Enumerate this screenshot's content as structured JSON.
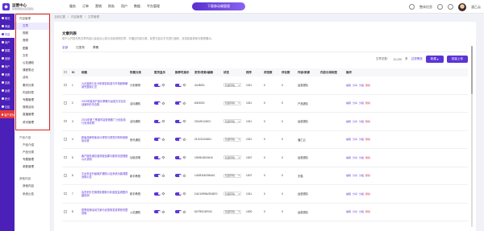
{
  "logo": {
    "title": "运营中心",
    "subtitle": "铁收钢组合运营团队"
  },
  "nav": [
    "服务",
    "订单",
    "营销",
    "财务",
    "用户",
    "数据",
    "平台管理"
  ],
  "promo_label": "下载移动端管理",
  "top_right": {
    "org": "整体信息",
    "user": "潘乙云"
  },
  "sidebar": [
    {
      "label": "概况",
      "name": "sidebar-item-overview"
    },
    {
      "label": "商品",
      "name": "sidebar-item-goods"
    },
    {
      "label": "内容",
      "name": "sidebar-item-content",
      "active": true
    },
    {
      "label": "用户",
      "name": "sidebar-item-users"
    },
    {
      "label": "数据",
      "name": "sidebar-item-data"
    },
    {
      "label": "营销",
      "name": "sidebar-item-marketing"
    },
    {
      "label": "商户",
      "name": "sidebar-item-merchants"
    },
    {
      "label": "设置",
      "name": "sidebar-item-settings"
    },
    {
      "label": "应用",
      "name": "sidebar-item-apps"
    },
    {
      "label": "运营",
      "name": "sidebar-item-ops"
    },
    {
      "label": "积分",
      "name": "sidebar-item-points"
    },
    {
      "label": "社区",
      "name": "sidebar-item-community"
    },
    {
      "label": "客户成功",
      "name": "sidebar-item-success",
      "red": true
    }
  ],
  "subnav": {
    "group1": "内容管理",
    "items": [
      "文章",
      "视频",
      "音频",
      "图集",
      "文件",
      "公告通知",
      "课程笔记",
      "活动",
      "素材分类",
      "内容标签",
      "专题管理",
      "音频活动",
      "直播管理",
      "资讯管理"
    ],
    "group2": "产品介绍",
    "items2": [
      "产品介绍",
      "产品分类",
      "专题管理",
      "参数管理"
    ],
    "group3": "其他内容",
    "items3": [
      "其他内容",
      "系统公告"
    ]
  },
  "breadcrumb": [
    "当前位置",
    "内容管理",
    "文章管理"
  ],
  "page": {
    "title": "文章列表",
    "desc1": "用于公开发布的文章内容以及站点公告与活动说明文章，可通过内容分类、标签与显示方式进行组织，支持批量排序与推荐展示。",
    "tabs": [
      "全部",
      "已发布",
      "草稿"
    ]
  },
  "toolbar": {
    "count_label": "文章总数：",
    "count": "10,230",
    "unit": "条",
    "filter": "过滤筛选",
    "new_btn": "新建",
    "batch_btn": "批量上传"
  },
  "table": {
    "headers": [
      "",
      "ID",
      "标题",
      "所属分类",
      "首页显示",
      "推荐可展示",
      "发布/更新/编辑",
      "状态",
      "排序",
      "浏览数",
      "评论数",
      "作者/来源",
      "内容分类标签",
      "操作"
    ],
    "rows": [
      {
        "id": "1",
        "title": "九月最新行业分析报告精选与市场趋势解读完整版汇总",
        "cat": "计划案例",
        "date": "4/1/8001",
        "status": "隐藏草稿",
        "sort": "1011",
        "hits": "0",
        "cmt": "0",
        "src": "运营团队"
      },
      {
        "id": "2",
        "title": "2023年度用户增长策略与运营方法论实战案例分享合集",
        "cat": "活动通知",
        "date": "6/5/1001",
        "status": "隐藏草稿",
        "sort": "1011",
        "hits": "0",
        "cmt": "0",
        "src": "产品团队"
      },
      {
        "id": "3",
        "title": "2024年第三季度内容营销推广计划及执行安排说明",
        "cat": "活动通知",
        "date": "23/1/6/1/2401",
        "status": "隐藏草稿",
        "sort": "1011",
        "hits": "0",
        "cmt": "0",
        "src": "运营团队"
      },
      {
        "id": "4",
        "title": "新版品牌形象设计规范与视觉识别系统使用手册",
        "cat": "资讯通告",
        "date": "21/1/41/24401",
        "status": "隐藏草稿",
        "sort": "1011",
        "hits": "0",
        "cmt": "0",
        "src": "潘乙云"
      },
      {
        "id": "5",
        "title": "客户服务满意度调查结果与服务改进措施公示说明",
        "cat": "功能说明",
        "date": "190/5/18/19410",
        "status": "隐藏草稿",
        "sort": "1007",
        "hits": "0",
        "cmt": "0",
        "src": "运营团队"
      },
      {
        "id": "6",
        "title": "平台安全升级维护通知以及系统功能调整说明公告",
        "cat": "新手教程",
        "date": "142/8118/196441",
        "status": "隐藏草稿",
        "sort": "1007",
        "hits": "0",
        "cmt": "0",
        "src": "天猫"
      },
      {
        "id": "7",
        "title": "会员积分兑换规则更新与年度权益调整详细说明",
        "cat": "新手教程",
        "date": "241/1/9994/254870",
        "status": "隐藏草稿",
        "sort": "1011",
        "hits": "0",
        "cmt": "0",
        "src": "运营团队"
      },
      {
        "id": "8",
        "title": "夏季促销活动方案与优惠券发放规则完整说明",
        "cat": "入站通知",
        "date": "52/750/187041",
        "status": "隐藏草稿",
        "sort": "1000",
        "hits": "0",
        "cmt": "0",
        "src": "运营团队"
      }
    ],
    "ops": [
      "编辑",
      "分享",
      "分组",
      "删除"
    ]
  }
}
